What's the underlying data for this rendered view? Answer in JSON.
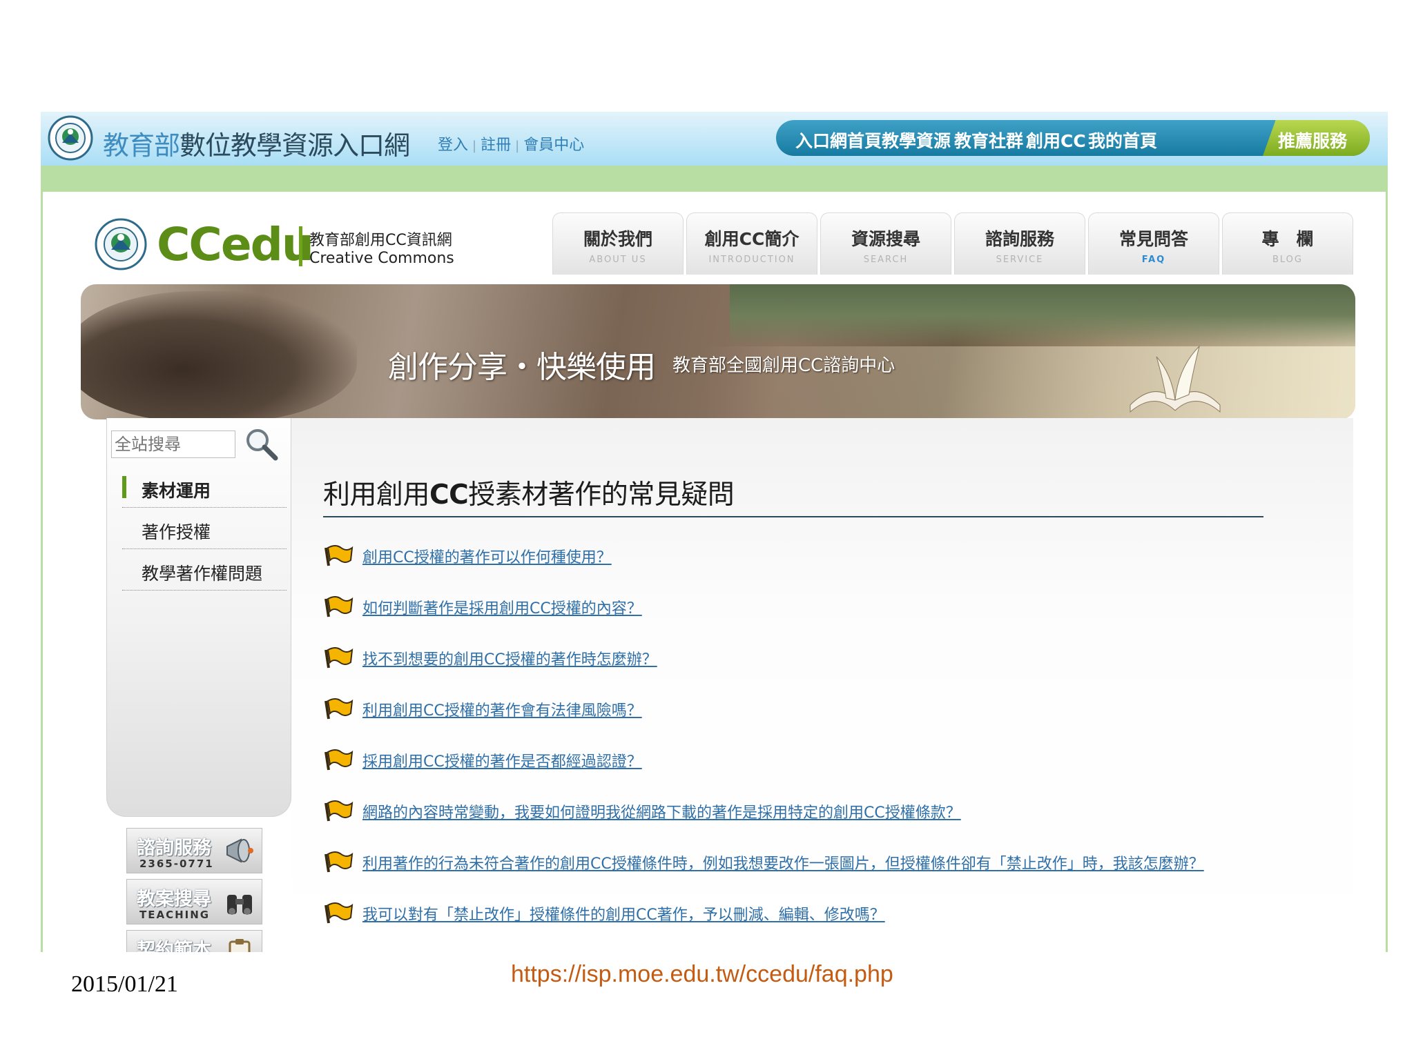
{
  "portal": {
    "title_part1": "教育部",
    "title_part2": "數位教學資源入口網",
    "login": "登入",
    "register": "註冊",
    "member_center": "會員中心",
    "nav": [
      "入口網首頁",
      "教學資源",
      "教育社群",
      "創用CC",
      "我的首頁"
    ],
    "recommended": "推薦服務"
  },
  "site": {
    "brand": "CCedu",
    "subtitle_line1": "教育部創用CC資訊網",
    "subtitle_line2": "Creative Commons",
    "tabs": [
      {
        "label": "關於我們",
        "sub": "ABOUT US"
      },
      {
        "label": "創用CC簡介",
        "sub": "INTRODUCTION"
      },
      {
        "label": "資源搜尋",
        "sub": "SEARCH"
      },
      {
        "label": "諮詢服務",
        "sub": "SERVICE"
      },
      {
        "label": "常見問答",
        "sub": "FAQ"
      },
      {
        "label": "專　欄",
        "sub": "BLOG"
      }
    ],
    "active_tab": "常見問答"
  },
  "banner": {
    "main": "創作分享・快樂使用",
    "sub": "教育部全國創用CC諮詢中心"
  },
  "sidebar": {
    "search_placeholder": "全站搜尋",
    "items": [
      "素材運用",
      "著作授權",
      "教學著作權問題"
    ],
    "active_item": "素材運用",
    "services": [
      {
        "label": "諮詢服務",
        "sub": "2365-0771"
      },
      {
        "label": "教案搜尋",
        "sub": "TEACHING"
      },
      {
        "label": "契約範本",
        "sub": ""
      }
    ]
  },
  "main": {
    "title_pre": "利用創用",
    "title_cc": "CC",
    "title_post": "授素材著作的常見疑問",
    "questions": [
      "創用CC授權的著作可以作何種使用？",
      "如何判斷著作是採用創用CC授權的內容？",
      "找不到想要的創用CC授權的著作時怎麼辦？",
      "利用創用CC授權的著作會有法律風險嗎？",
      "採用創用CC授權的著作是否都經過認證？",
      "網路的內容時常變動，我要如何證明我從網路下載的著作是採用特定的創用CC授權條款？",
      "利用著作的行為未符合著作的創用CC授權條件時，例如我想要改作一張圖片，但授權條件卻有「禁止改作」時，我該怎麼辦？",
      "我可以對有「禁止改作」授權條件的創用CC著作，予以刪減、編輯、修改嗎？"
    ]
  },
  "footer": {
    "date": "2015/01/21",
    "url": "https://isp.moe.edu.tw/ccedu/faq.php"
  },
  "colors": {
    "portal_nav": "#177aa1",
    "recommended": "#7cac21",
    "brand_green": "#5b8d17",
    "link_blue": "#2f6fa8",
    "url_orange": "#c55a11"
  }
}
